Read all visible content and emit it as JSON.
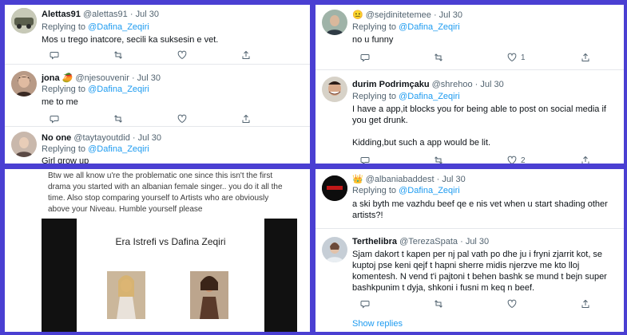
{
  "panel1": {
    "tweets": [
      {
        "name": "Alettas91",
        "handle": "@alettas91",
        "time": "· Jul 30",
        "replying_prefix": "Replying to",
        "mention": "@Dafina_Zeqiri",
        "text": "Mos u trego inatcore, secili ka suksesin e vet."
      },
      {
        "name": "jona",
        "handle": "@njesouvenir",
        "time": "· Jul 30",
        "replying_prefix": "Replying to",
        "mention": "@Dafina_Zeqiri",
        "text": "me to me"
      },
      {
        "name": "No one",
        "handle": "@taytayoutdid",
        "time": "· Jul 30",
        "replying_prefix": "Replying to",
        "mention": "@Dafina_Zeqiri",
        "text": "Girl grow up"
      }
    ]
  },
  "panel2": {
    "tweets": [
      {
        "name": "",
        "handle": "@sejdinitetemee",
        "time": "· Jul 30",
        "replying_prefix": "Replying to",
        "mention": "@Dafina_Zeqiri",
        "text": "no u funny",
        "like_count": "1"
      },
      {
        "name": "durim Podrimçaku",
        "handle": "@shrehoo",
        "time": "· Jul 30",
        "replying_prefix": "Replying to",
        "mention": "@Dafina_Zeqiri",
        "text1": "I have a app,it blocks you for being able to post on social media if you get drunk.",
        "text2": "Kidding,but such a app would be lit.",
        "like_count": "2"
      }
    ]
  },
  "panel3": {
    "quote_text": "Btw we all know u're the problematic one since this isn't the first drama you started with an albanian female singer.. you do it all the time. Also stop comparing yourself to Artists who are obviously above your Niveau. Humble yourself please",
    "media_title": "Era Istrefi vs Dafina Zeqiri"
  },
  "panel4": {
    "tweets": [
      {
        "name": "",
        "handle": "@albaniabaddest",
        "time": "· Jul 30",
        "replying_prefix": "Replying to",
        "mention": "@Dafina_Zeqiri",
        "text": "a ski byth me vazhdu beef qe e nis vet when u start shading other artists?!"
      },
      {
        "name": "Terthelibra",
        "handle": "@TerezaSpata",
        "time": "· Jul 30",
        "text": "Sjam dakort t kapen per nj pal vath po dhe ju i fryni zjarrit kot, se kuptoj pse keni qejf t hapni sherre midis njerzve me kto lloj komentesh. N vend t'i pajtoni t behen bashk se mund t bejn super bashkpunim t dyja, shkoni i fusni m keq n beef."
      }
    ],
    "show_replies": "Show replies"
  },
  "icons": {
    "reply": "reply-icon",
    "retweet": "retweet-icon",
    "like": "heart-icon",
    "share": "share-icon"
  },
  "colors": {
    "background": "#4a3fd2",
    "accent": "#1d9bf0"
  }
}
